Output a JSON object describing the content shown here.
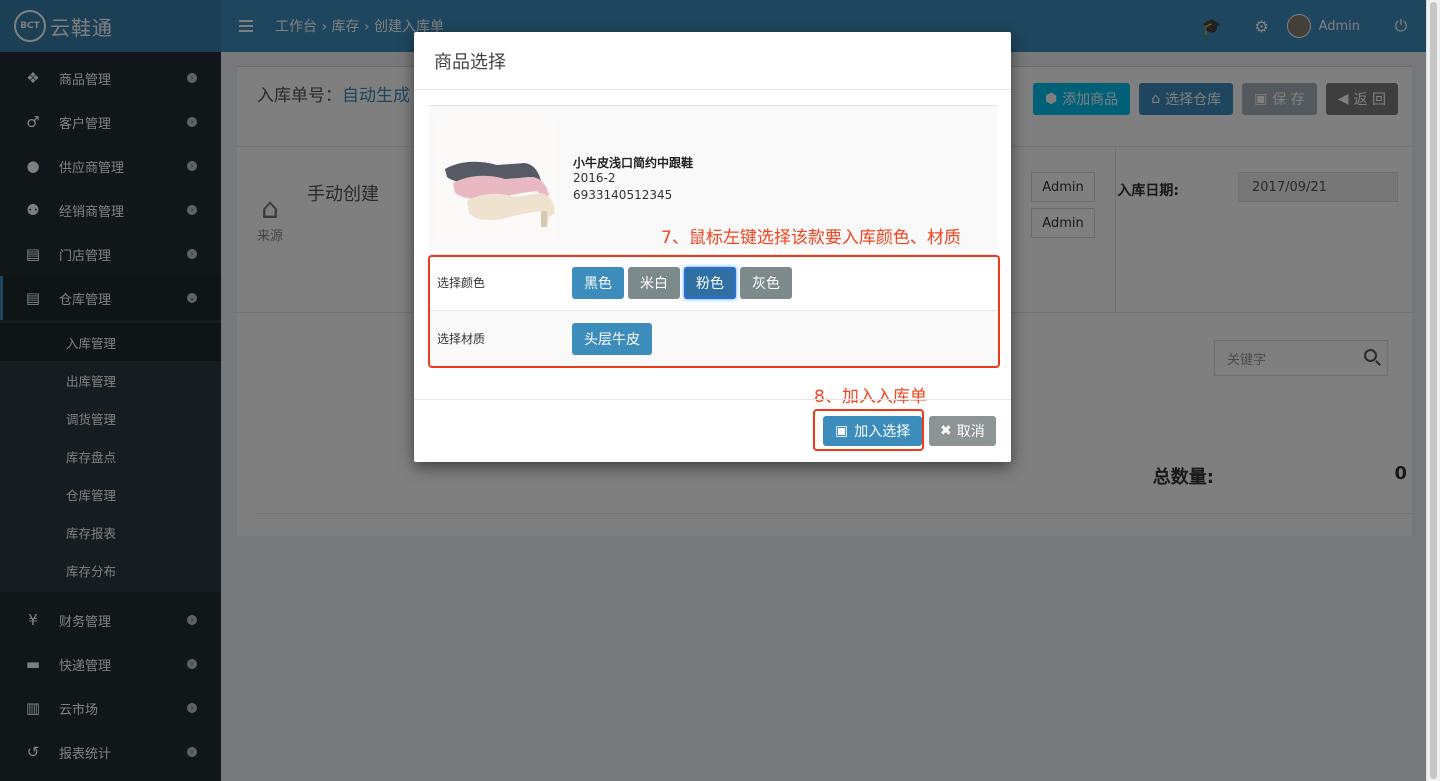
{
  "app": {
    "logo_badge": "BCT",
    "name": "云鞋通"
  },
  "sidebar": {
    "items": [
      {
        "label": "商品管理",
        "icon": "cubes-icon"
      },
      {
        "label": "客户管理",
        "icon": "male-icon"
      },
      {
        "label": "供应商管理",
        "icon": "user-icon"
      },
      {
        "label": "经销商管理",
        "icon": "users-icon"
      },
      {
        "label": "门店管理",
        "icon": "archive-icon"
      },
      {
        "label": "仓库管理",
        "icon": "archive-icon"
      }
    ],
    "submenu": [
      {
        "label": "入库管理"
      },
      {
        "label": "出库管理"
      },
      {
        "label": "调货管理"
      },
      {
        "label": "库存盘点"
      },
      {
        "label": "仓库管理"
      },
      {
        "label": "库存报表"
      },
      {
        "label": "库存分布"
      }
    ],
    "items_after": [
      {
        "label": "财务管理",
        "icon": "yen-icon"
      },
      {
        "label": "快递管理",
        "icon": "truck-icon"
      },
      {
        "label": "云市场",
        "icon": "building-icon"
      },
      {
        "label": "报表统计",
        "icon": "history-icon"
      }
    ]
  },
  "header": {
    "breadcrumb": "工作台 › 库存 › 创建入库单",
    "user": "Admin"
  },
  "page": {
    "order_label": "入库单号：",
    "order_value": "自动生成",
    "btn_add_product": "添加商品",
    "btn_select_warehouse": "选择仓库",
    "btn_save": "保 存",
    "btn_back": "返 回",
    "source_label": "来源",
    "source_value": "手动创建",
    "admin1": "Admin",
    "admin2": "Admin",
    "date_label": "入库日期:",
    "date_value": "2017/09/21",
    "search_placeholder": "关键字",
    "total_label": "总数量:",
    "total_value": "0"
  },
  "modal": {
    "title": "商品选择",
    "product": {
      "name": "小牛皮浅口简约中跟鞋",
      "season": "2016-2",
      "barcode": "6933140512345"
    },
    "annotation_7": "7、鼠标左键选择该款要入库颜色、材质",
    "annotation_8": "8、加入入库单",
    "color_label": "选择颜色",
    "colors": [
      "黑色",
      "米白",
      "粉色",
      "灰色"
    ],
    "selected_color": "粉色",
    "material_label": "选择材质",
    "materials": [
      "头层牛皮"
    ],
    "btn_confirm": "加入选择",
    "btn_cancel": "取消"
  }
}
